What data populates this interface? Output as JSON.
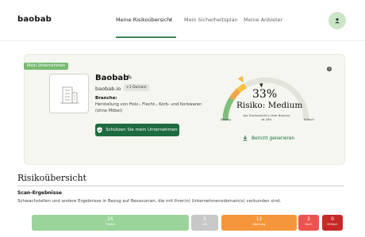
{
  "header": {
    "logo": "baobab",
    "nav": [
      {
        "label": "Meine Risikoübersicht",
        "active": true
      },
      {
        "label": "Mein Sicherheitsplan",
        "active": false
      },
      {
        "label": "Meine Anbieter",
        "active": false
      }
    ]
  },
  "company": {
    "badge": "Mein Unternehmen",
    "name": "Baobab",
    "domain": "baobab.io",
    "domain_chip": "+1 Domain",
    "branche_heading": "Branche:",
    "branche_text": "Herstellung von Holz-, Flecht-, Korb- und Korkwaren (ohne Möbel)",
    "protect_button": "Schützen Sie mein Unternehmen"
  },
  "risk": {
    "percent": "33%",
    "percent_value": 33,
    "industry_average_percent": 18,
    "label": "Risiko: Medium",
    "average_note": "Der Durchschnitt in Ihrer Branche ist 18%",
    "scale_low": "Niedrig",
    "scale_high": "Kritisch",
    "report_button": "Bericht generieren"
  },
  "overview": {
    "title": "Risikoübersicht",
    "scan_heading": "Scan-Ergebnisse",
    "scan_text": "Schwachstellen und andere Ergebnisse in Bezug auf Ressourcen, die mit Ihrer(n) Unternehmensdomain(s) verbunden sind.",
    "results": [
      {
        "count": "25",
        "label": "Positiv"
      },
      {
        "count": "5",
        "label": "Info"
      },
      {
        "count": "12",
        "label": "Warnung"
      },
      {
        "count": "2",
        "label": "Hoch"
      },
      {
        "count": "0",
        "label": "Kritisch"
      }
    ]
  },
  "colors": {
    "primary_green": "#1e6b40",
    "positive": "#9ad49a",
    "info": "#c8c8c8",
    "warning": "#f6963c",
    "high": "#ef5350",
    "critical": "#c62828",
    "gauge_yellow": "#f5c242",
    "gauge_orange": "#f0a44a",
    "gauge_green": "#7fbf7a"
  }
}
